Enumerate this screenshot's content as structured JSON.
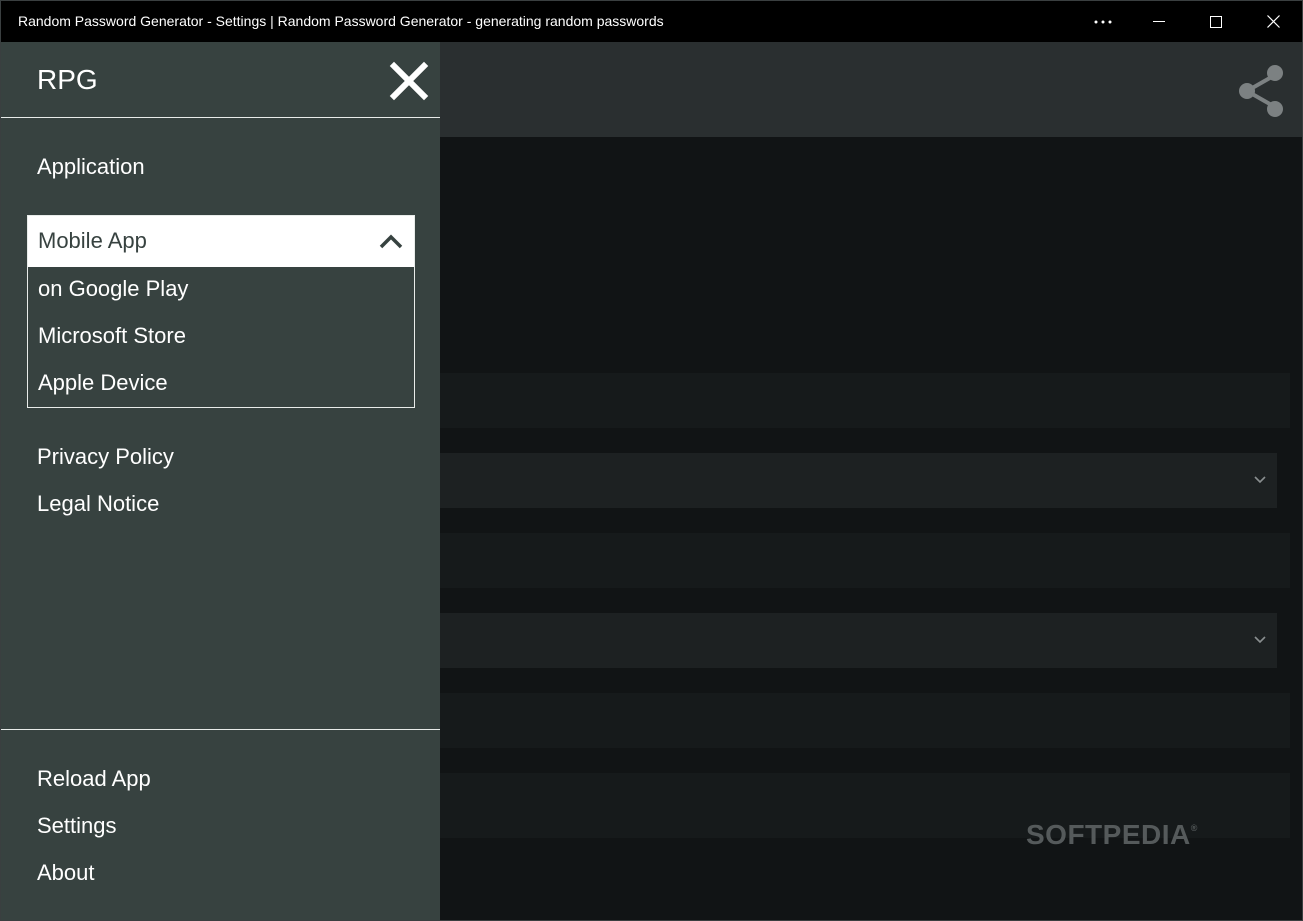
{
  "window": {
    "title": "Random Password Generator - Settings | Random Password Generator - generating random passwords",
    "controls": [
      "more-icon",
      "minimize-icon",
      "maximize-icon",
      "close-icon"
    ]
  },
  "header": {
    "share_icon": "share-icon"
  },
  "drawer": {
    "brand": "RPG",
    "close_icon": "close-x-icon",
    "application": "Application",
    "mobile_app": {
      "label": "Mobile App",
      "expanded": true,
      "options": [
        "on Google Play",
        "Microsoft Store",
        "Apple Device"
      ]
    },
    "links": [
      "Privacy Policy",
      "Legal Notice"
    ],
    "footer": [
      "Reload App",
      "Settings",
      "About"
    ]
  },
  "watermark": {
    "text": "SOFTPEDIA",
    "mark": "®"
  },
  "colors": {
    "drawer_bg": "#374240",
    "titlebar_bg": "#000000",
    "header_bg": "#2a2f30",
    "content_bg": "#111415",
    "dropdown_head_bg": "#ffffff"
  }
}
